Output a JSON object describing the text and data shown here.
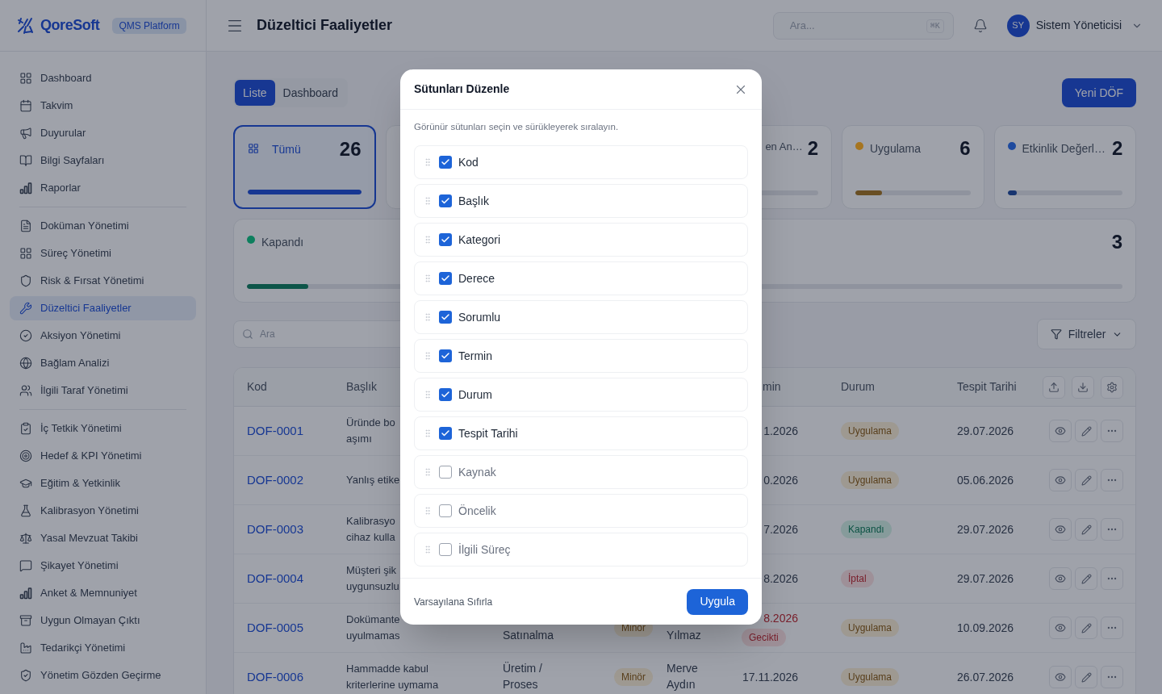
{
  "brand": {
    "name": "QoreSoft",
    "badge": "QMS Platform"
  },
  "header": {
    "title": "Düzeltici Faaliyetler",
    "search": {
      "placeholder": "Ara...",
      "shortcut": "⌘K"
    },
    "user": {
      "initials": "SY",
      "name": "Sistem Yöneticisi"
    }
  },
  "sidebar": {
    "groups": [
      {
        "items": [
          {
            "label": "Dashboard",
            "selected": false
          },
          {
            "label": "Takvim",
            "selected": false
          },
          {
            "label": "Duyurular",
            "selected": false
          },
          {
            "label": "Bilgi Sayfaları",
            "selected": false
          },
          {
            "label": "Raporlar",
            "selected": false
          }
        ]
      },
      {
        "items": [
          {
            "label": "Doküman Yönetimi",
            "selected": false
          },
          {
            "label": "Süreç Yönetimi",
            "selected": false
          },
          {
            "label": "Risk & Fırsat Yönetimi",
            "selected": false
          },
          {
            "label": "Düzeltici Faaliyetler",
            "selected": true
          },
          {
            "label": "Aksiyon Yönetimi",
            "selected": false
          },
          {
            "label": "Bağlam Analizi",
            "selected": false
          },
          {
            "label": "İlgili Taraf Yönetimi",
            "selected": false
          }
        ]
      },
      {
        "items": [
          {
            "label": "İç Tetkik Yönetimi",
            "selected": false
          },
          {
            "label": "Hedef & KPI Yönetimi",
            "selected": false
          },
          {
            "label": "Eğitim & Yetkinlik",
            "selected": false
          },
          {
            "label": "Kalibrasyon Yönetimi",
            "selected": false
          },
          {
            "label": "Yasal Mevzuat Takibi",
            "selected": false
          },
          {
            "label": "Şikayet Yönetimi",
            "selected": false
          },
          {
            "label": "Anket & Memnuniyet",
            "selected": false
          },
          {
            "label": "Uygun Olmayan Çıktı",
            "selected": false
          },
          {
            "label": "Tedarikçi Yönetimi",
            "selected": false
          },
          {
            "label": "Yönetim Gözden Geçirme",
            "selected": false
          }
        ]
      }
    ]
  },
  "view_tabs": [
    {
      "label": "Liste",
      "selected": true
    },
    {
      "label": "Dashboard",
      "selected": false
    }
  ],
  "new_button": "Yeni DÖF",
  "stat_cards": [
    {
      "kind": "all",
      "label": "Tümü",
      "count": "26",
      "level": 1,
      "selected": true
    },
    {
      "kind": "hidden"
    },
    {
      "kind": "status",
      "label": "en An…",
      "count": "2",
      "selected": false
    },
    {
      "kind": "status",
      "label": "Uygulama",
      "count": "6",
      "level": 0.23,
      "color": "#a67520",
      "selected": false
    },
    {
      "kind": "status",
      "label": "Etkinlik Değerl…",
      "count": "2",
      "level": 0.08,
      "color": "#1e4a9e",
      "selected": false
    }
  ],
  "wide_card": {
    "label": "Kapandı",
    "count": "3",
    "level": 0.07,
    "color": "#0d7f5e",
    "selected": false
  },
  "search": {
    "placeholder": "Ara"
  },
  "filter_button": "Filtreler",
  "table": {
    "columns": [
      "Kod",
      "Başlık",
      "min",
      "Durum",
      "Tespit Tarihi"
    ],
    "rows": [
      {
        "code": "DOF-0001",
        "title": [
          "Üründe bo",
          "aşımı"
        ],
        "category": [],
        "owner": [],
        "due": "1.2026",
        "overdue": false,
        "status": {
          "text": "Uygulama",
          "kind": "warning"
        },
        "date": "29.07.2026"
      },
      {
        "code": "DOF-0002",
        "title": [
          "Yanlış etike"
        ],
        "category": [],
        "owner": [],
        "due": "0.2026",
        "overdue": false,
        "status": {
          "text": "Uygulama",
          "kind": "warning"
        },
        "date": "05.06.2026"
      },
      {
        "code": "DOF-0003",
        "title": [
          "Kalibrasyo",
          "cihaz kulla"
        ],
        "category": [],
        "owner": [],
        "due": "7.2026",
        "overdue": false,
        "status": {
          "text": "Kapandı",
          "kind": "success"
        },
        "date": "29.07.2026"
      },
      {
        "code": "DOF-0004",
        "title": [
          "Müşteri şik",
          "uygunsuzlu"
        ],
        "category": [],
        "owner": [],
        "due": "8.2026",
        "overdue": false,
        "status": {
          "text": "İptal",
          "kind": "danger"
        },
        "date": "29.07.2026"
      },
      {
        "code": "DOF-0005",
        "title": [
          "Dokümante",
          "uyulmamas"
        ],
        "category": [
          "Satınalma"
        ],
        "severity": {
          "text": "Minör",
          "kind": "warning"
        },
        "owner": [
          "Yılmaz"
        ],
        "due": "8.2026",
        "overdue": true,
        "overdue_label": "Gecikti",
        "status": {
          "text": "Uygulama",
          "kind": "warning"
        },
        "date": "10.09.2026"
      },
      {
        "code": "DOF-0006",
        "title": [
          "Hammadde kabul",
          "kriterlerine uymama"
        ],
        "category": [
          "Üretim /",
          "Proses"
        ],
        "severity": {
          "text": "Minör",
          "kind": "warning"
        },
        "owner": [
          "Merve",
          "Aydın"
        ],
        "due": "17.11.2026",
        "overdue": false,
        "status": {
          "text": "Uygulama",
          "kind": "warning"
        },
        "date": "26.07.2026"
      }
    ]
  },
  "dialog": {
    "title": "Sütunları Düzenle",
    "description": "Görünür sütunları seçin ve sürükleyerek sıralayın.",
    "columns": [
      {
        "label": "Kod",
        "checked": true
      },
      {
        "label": "Başlık",
        "checked": true
      },
      {
        "label": "Kategori",
        "checked": true
      },
      {
        "label": "Derece",
        "checked": true
      },
      {
        "label": "Sorumlu",
        "checked": true
      },
      {
        "label": "Termin",
        "checked": true
      },
      {
        "label": "Durum",
        "checked": true
      },
      {
        "label": "Tespit Tarihi",
        "checked": true
      },
      {
        "label": "Kaynak",
        "checked": false
      },
      {
        "label": "Öncelik",
        "checked": false
      },
      {
        "label": "İlgili Süreç",
        "checked": false
      }
    ],
    "reset": "Varsayılana Sıfırla",
    "apply": "Uygula"
  }
}
